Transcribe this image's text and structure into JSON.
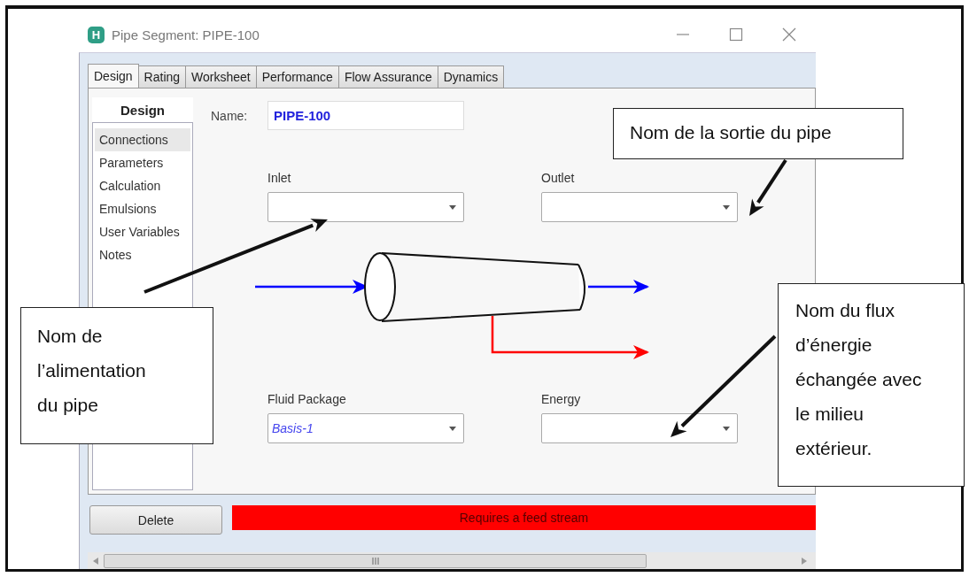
{
  "window": {
    "logo_letter": "H",
    "title": "Pipe Segment: PIPE-100"
  },
  "tabs": [
    {
      "label": "Design",
      "selected": true
    },
    {
      "label": "Rating",
      "selected": false
    },
    {
      "label": "Worksheet",
      "selected": false
    },
    {
      "label": "Performance",
      "selected": false
    },
    {
      "label": "Flow Assurance",
      "selected": false
    },
    {
      "label": "Dynamics",
      "selected": false
    }
  ],
  "sidebar": {
    "title": "Design",
    "items": [
      {
        "label": "Connections",
        "selected": true
      },
      {
        "label": "Parameters",
        "selected": false
      },
      {
        "label": "Calculation",
        "selected": false
      },
      {
        "label": "Emulsions",
        "selected": false
      },
      {
        "label": "User Variables",
        "selected": false
      },
      {
        "label": "Notes",
        "selected": false
      }
    ]
  },
  "name_field": {
    "label": "Name:",
    "value": "PIPE-100"
  },
  "dropdowns": [
    {
      "label": "Inlet"
    },
    {
      "label": "Outlet"
    },
    {
      "label": "Fluid Package",
      "value": "Basis-1"
    },
    {
      "label": "Energy"
    }
  ],
  "delete_button": "Delete",
  "status": {
    "kind": "error",
    "text": "Requires a feed stream"
  },
  "callouts": [
    {
      "text": "Nom de l’alimentation du pipe"
    },
    {
      "text": "Nom de la sortie du pipe"
    },
    {
      "text": "Nom du flux d’énergie échangée avec le milieu extérieur."
    }
  ]
}
